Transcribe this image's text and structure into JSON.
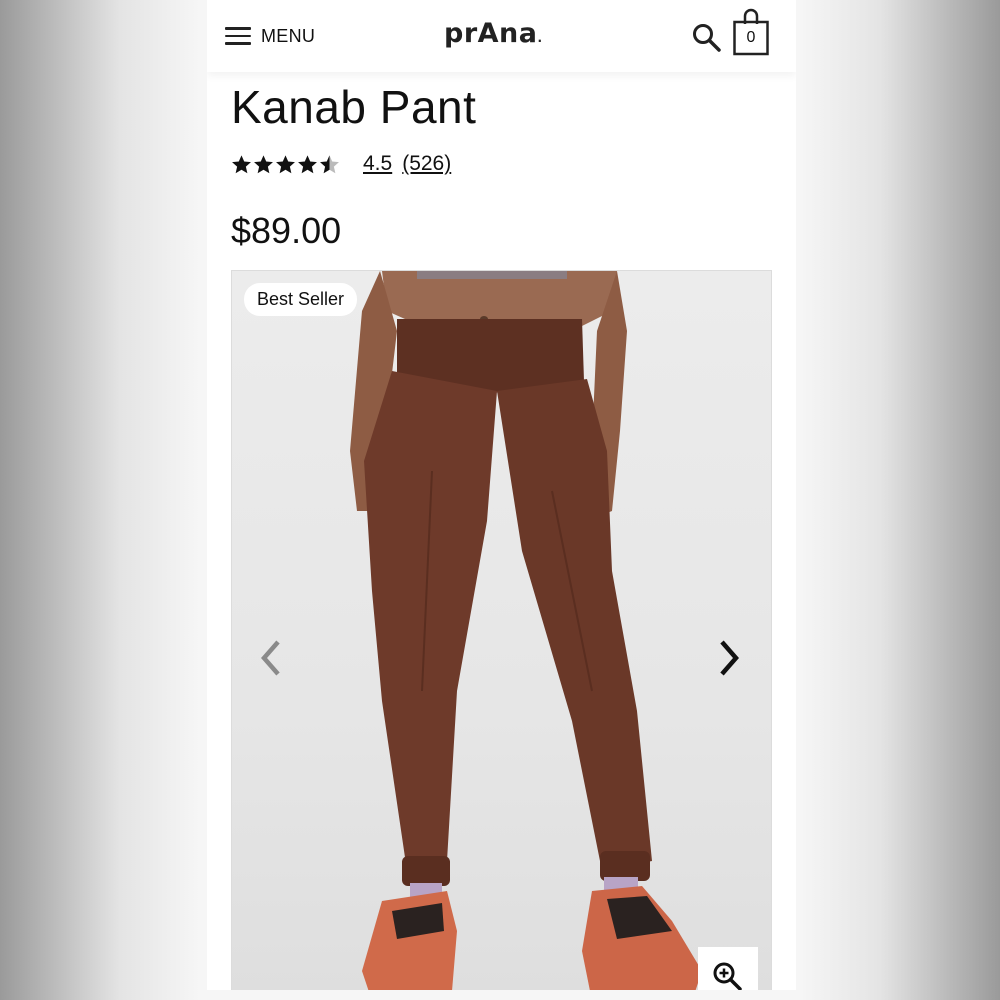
{
  "header": {
    "menu_label": "MENU",
    "logo_text": "prAna",
    "logo_dot": ".",
    "cart_count": "0"
  },
  "product": {
    "title": "Kanab Pant",
    "rating": 4.5,
    "rating_label": "4.5",
    "review_count": "(526)",
    "price": "$89.00",
    "badge": "Best Seller"
  },
  "icons": {
    "menu": "hamburger-icon",
    "search": "search-icon",
    "cart": "shopping-bag-icon",
    "prev": "chevron-left-icon",
    "next": "chevron-right-icon",
    "zoom": "zoom-in-icon",
    "star": "star-icon"
  },
  "colors": {
    "text": "#111111",
    "pants": "#6e3a2a",
    "shoe": "#d06a4a",
    "background": "#ffffff"
  }
}
